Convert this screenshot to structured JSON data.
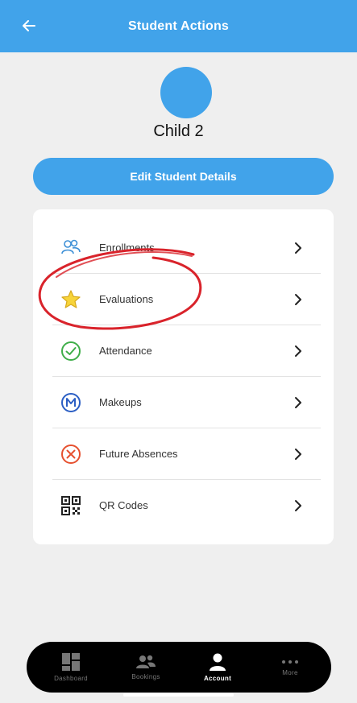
{
  "header": {
    "title": "Student Actions"
  },
  "student": {
    "name": "Child 2"
  },
  "edit_button": {
    "label": "Edit Student Details"
  },
  "actions": [
    {
      "label": "Enrollments",
      "icon": "people-icon"
    },
    {
      "label": "Evaluations",
      "icon": "star-icon"
    },
    {
      "label": "Attendance",
      "icon": "check-circle-icon"
    },
    {
      "label": "Makeups",
      "icon": "m-circle-icon"
    },
    {
      "label": "Future Absences",
      "icon": "x-circle-icon"
    },
    {
      "label": "QR Codes",
      "icon": "qr-code-icon"
    }
  ],
  "tabs": [
    {
      "label": "Dashboard",
      "icon": "dashboard-icon",
      "active": false
    },
    {
      "label": "Bookings",
      "icon": "bookings-icon",
      "active": false
    },
    {
      "label": "Account",
      "icon": "account-icon",
      "active": true
    },
    {
      "label": "More",
      "icon": "more-icon",
      "active": false
    }
  ],
  "colors": {
    "primary": "#41a3ea",
    "background": "#efefef",
    "annotation": "#d9232b"
  }
}
